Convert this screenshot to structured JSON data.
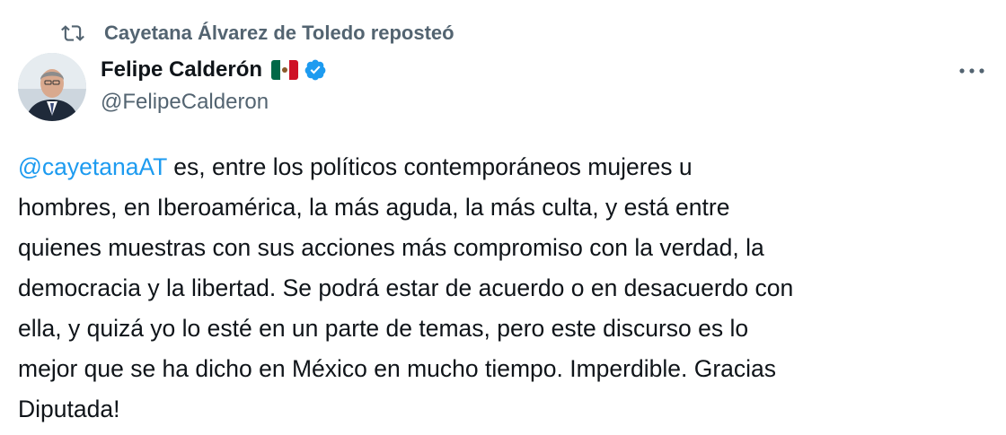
{
  "social_context": {
    "label": "Cayetana Álvarez de Toledo reposteó",
    "icon": "repost-icon"
  },
  "author": {
    "display_name": "Felipe Calderón",
    "flag": "mexico-flag-emoji",
    "verified": true,
    "handle": "@FelipeCalderon"
  },
  "more_menu": {
    "icon": "more-horizontal-icon"
  },
  "tweet": {
    "mention": "@cayetanaAT",
    "lines": [
      " es, entre los políticos contemporáneos mujeres u",
      "hombres, en Iberoamérica, la más aguda, la más culta, y está entre",
      "quienes muestras con sus acciones más compromiso con la verdad, la",
      "democracia y la libertad. Se podrá estar de acuerdo o en desacuerdo con",
      "ella, y quizá yo lo esté en un parte de temas, pero este discurso es lo",
      "mejor que se ha dicho en México en mucho tiempo. Imperdible. Gracias",
      "Diputada!"
    ]
  },
  "colors": {
    "text": "#0f1419",
    "secondary": "#536471",
    "accent": "#1d9bf0"
  }
}
